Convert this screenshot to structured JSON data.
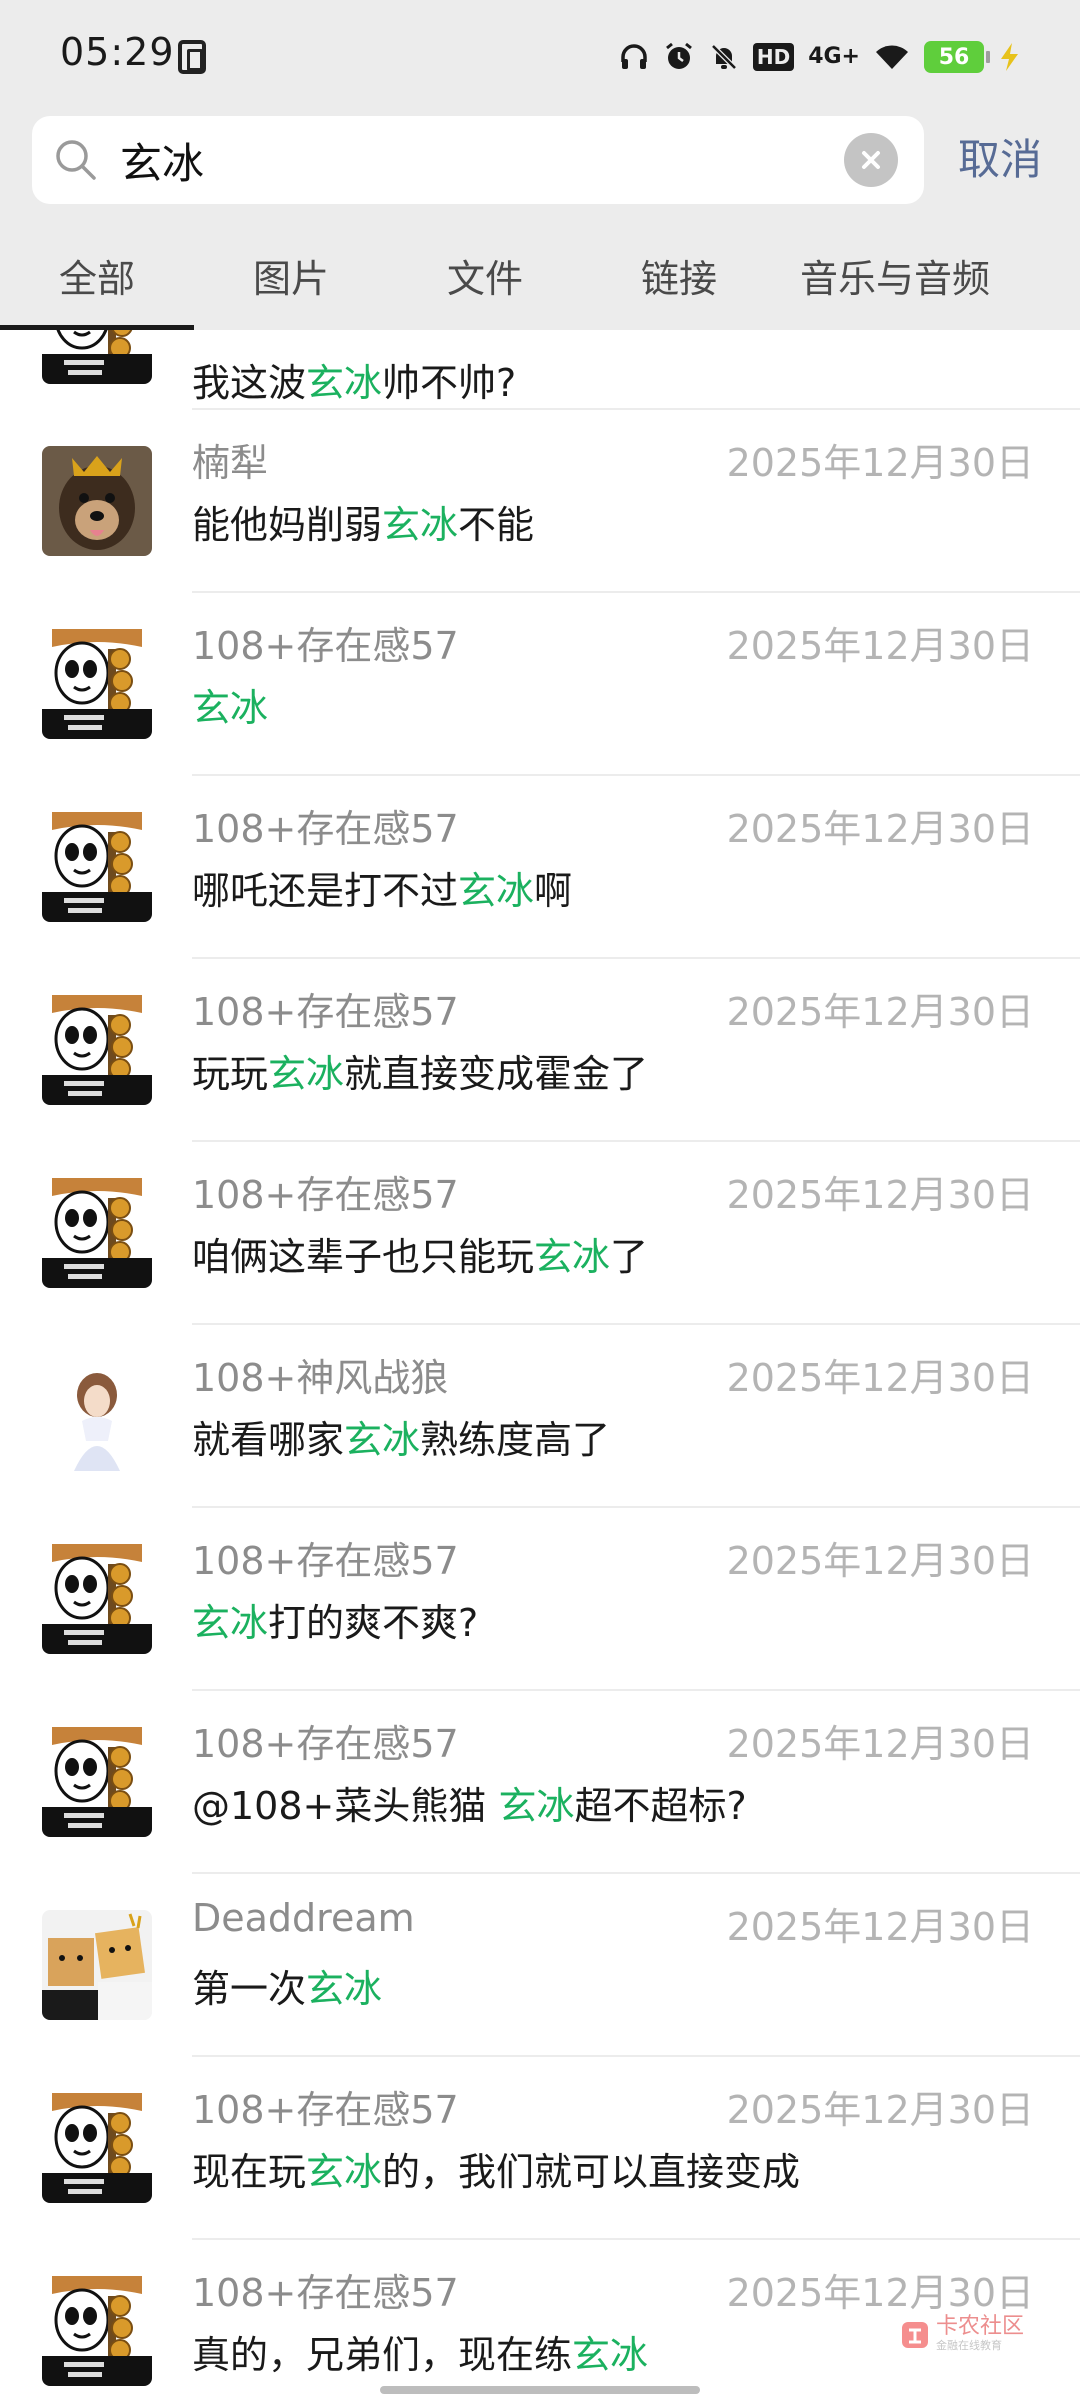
{
  "status_bar": {
    "time": "05:29",
    "hd_label": "HD",
    "network_label": "4G+",
    "battery_level": "56"
  },
  "search": {
    "query": "玄冰",
    "cancel_label": "取消"
  },
  "tabs": [
    {
      "label": "全部",
      "active": true
    },
    {
      "label": "图片",
      "active": false
    },
    {
      "label": "文件",
      "active": false
    },
    {
      "label": "链接",
      "active": false
    },
    {
      "label": "音乐与音频",
      "active": false
    }
  ],
  "highlight_color": "#1bb15f",
  "partial_result": {
    "avatar": "meme-avatar",
    "message_pre": "我这波",
    "message_hl": "玄冰",
    "message_post": "帅不帅?"
  },
  "results": [
    {
      "sender": "楠犁",
      "date": "2025年12月30日",
      "avatar": "dog-avatar",
      "pre": "能他妈削弱",
      "hl": "玄冰",
      "post": "不能"
    },
    {
      "sender": "108+存在感57",
      "date": "2025年12月30日",
      "avatar": "meme-avatar",
      "pre": "",
      "hl": "玄冰",
      "post": ""
    },
    {
      "sender": "108+存在感57",
      "date": "2025年12月30日",
      "avatar": "meme-avatar",
      "pre": "哪吒还是打不过",
      "hl": "玄冰",
      "post": "啊"
    },
    {
      "sender": "108+存在感57",
      "date": "2025年12月30日",
      "avatar": "meme-avatar",
      "pre": "玩玩",
      "hl": "玄冰",
      "post": "就直接变成霍金了"
    },
    {
      "sender": "108+存在感57",
      "date": "2025年12月30日",
      "avatar": "meme-avatar",
      "pre": "咱俩这辈子也只能玩",
      "hl": "玄冰",
      "post": "了"
    },
    {
      "sender": "108+神风战狼",
      "date": "2025年12月30日",
      "avatar": "girl-avatar",
      "pre": "就看哪家",
      "hl": "玄冰",
      "post": "熟练度高了"
    },
    {
      "sender": "108+存在感57",
      "date": "2025年12月30日",
      "avatar": "meme-avatar",
      "pre": "",
      "hl": "玄冰",
      "post": "打的爽不爽?"
    },
    {
      "sender": "108+存在感57",
      "date": "2025年12月30日",
      "avatar": "meme-avatar",
      "pre": "@108+菜头熊猫 ",
      "hl": "玄冰",
      "post": "超不超标?"
    },
    {
      "sender": "Deaddream",
      "date": "2025年12月30日",
      "avatar": "duo-avatar",
      "pre": "第一次",
      "hl": "玄冰",
      "post": ""
    },
    {
      "sender": "108+存在感57",
      "date": "2025年12月30日",
      "avatar": "meme-avatar",
      "pre": "现在玩",
      "hl": "玄冰",
      "post": "的，我们就可以直接变成"
    },
    {
      "sender": "108+存在感57",
      "date": "2025年12月30日",
      "avatar": "meme-avatar",
      "pre": "真的，兄弟们，现在练",
      "hl": "玄冰",
      "post": ""
    }
  ],
  "watermark": {
    "text": "卡农社区",
    "sub": "金融在线教育"
  }
}
